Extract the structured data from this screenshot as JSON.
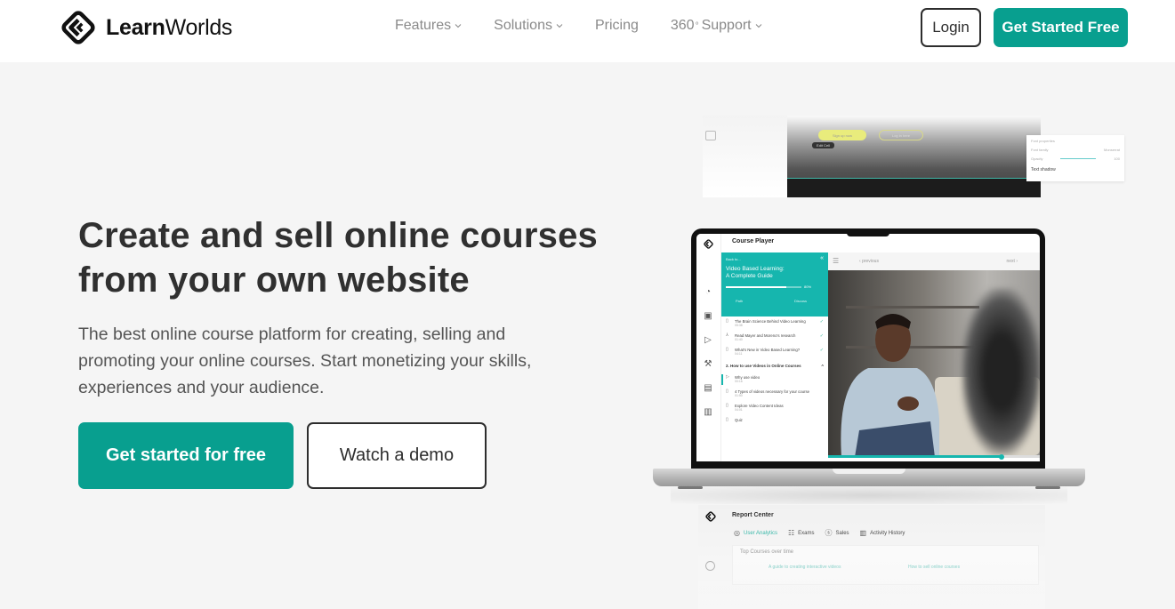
{
  "header": {
    "logo_bold": "Learn",
    "logo_regular": "Worlds",
    "nav": [
      {
        "label": "Features",
        "has_dropdown": true
      },
      {
        "label": "Solutions",
        "has_dropdown": true
      },
      {
        "label": "Pricing",
        "has_dropdown": false
      },
      {
        "label": "360",
        "superscript": "°",
        "label_suffix": "Support",
        "has_dropdown": true
      }
    ],
    "login_label": "Login",
    "cta_label": "Get Started Free"
  },
  "hero": {
    "title_line1": "Create and sell online courses",
    "title_line2": "from your own website",
    "subtitle": "The best online course platform for creating, selling and promoting your online courses. Start monetizing your skills, experiences and your audience.",
    "primary_button": "Get started for free",
    "secondary_button": "Watch a demo"
  },
  "editor_mock": {
    "primary_pill": "Sign up now",
    "secondary_pill": "Log in here",
    "edit_cell": "Edit Cell",
    "panel_title": "Font properties",
    "font_family_label": "Font family",
    "font_family_value": "Monserrat",
    "opacity_label": "Opacity",
    "opacity_value": "100",
    "opacity_unit": "%",
    "text_shadow_label": "Text shadow"
  },
  "course_player": {
    "title": "Course Player",
    "back_label": "Back to...",
    "course_title_line1": "Video Based Learning:",
    "course_title_line2": "A Complete Guide",
    "progress_percent": 80,
    "progress_label": "80%",
    "tabs": [
      "Path",
      "Discuss"
    ],
    "items_section1": [
      {
        "title": "The Brain Science Behind Video Learning",
        "time": "05:38",
        "icon": "book-icon",
        "done": true
      },
      {
        "title": "Read Mayer and Moreno's research",
        "time": "01:40",
        "icon": "pdf-icon",
        "done": true
      },
      {
        "title": "What's New in Video Based Learning?",
        "time": "04:11",
        "icon": "book-icon",
        "done": true
      }
    ],
    "section2_title": "2. How to use Videos in Online Courses",
    "items_section2": [
      {
        "title": "Why use video",
        "time": "00:16",
        "icon": "play-icon",
        "active": true
      },
      {
        "title": "4 Types of videos necessary for your course",
        "time": "01:50",
        "icon": "book-icon"
      },
      {
        "title": "Explore Video Content Ideas",
        "time": "04:01",
        "icon": "book-icon"
      },
      {
        "title": "Quiz",
        "time": "",
        "icon": "book-icon"
      }
    ],
    "prev_label": "previous",
    "next_label": "next",
    "video_progress": 0.82
  },
  "report_center": {
    "title": "Report Center",
    "tabs": [
      {
        "label": "User Analytics",
        "icon": "user-circle-icon",
        "active": true
      },
      {
        "label": "Exams",
        "icon": "list-icon"
      },
      {
        "label": "Sales",
        "icon": "dollar-icon"
      },
      {
        "label": "Activity History",
        "icon": "chart-icon"
      }
    ],
    "panel_title": "Top Courses over time",
    "links": [
      "A guide to creating interactive videos",
      "How to sell online courses"
    ]
  },
  "colors": {
    "brand": "#089f8f",
    "accent_teal": "#16b6ae",
    "text_dark": "#2d2d2d",
    "nav_gray": "#8a8a8a",
    "background": "#f5f5f5"
  }
}
